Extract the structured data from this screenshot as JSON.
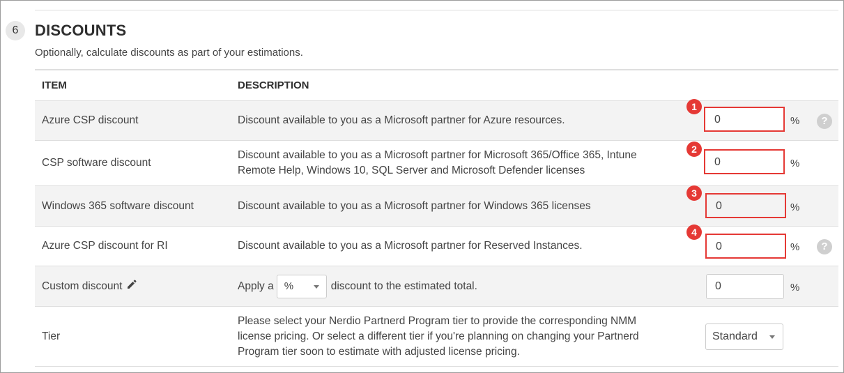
{
  "section": {
    "step": "6",
    "title": "DISCOUNTS",
    "subtitle": "Optionally, calculate discounts as part of your estimations."
  },
  "table": {
    "headers": {
      "item": "ITEM",
      "description": "DESCRIPTION"
    },
    "rows": [
      {
        "item": "Azure CSP discount",
        "description": "Discount available to you as a Microsoft partner for Azure resources.",
        "value": "0",
        "unit": "%",
        "marker": "1",
        "help_icon": "question-circle-icon"
      },
      {
        "item": "CSP software discount",
        "description": "Discount available to you as a Microsoft partner for Microsoft 365/Office 365, Intune Remote Help, Windows 10, SQL Server and Microsoft Defender licenses",
        "value": "0",
        "unit": "%",
        "marker": "2"
      },
      {
        "item": "Windows 365 software discount",
        "description": "Discount available to you as a Microsoft partner for Windows 365 licenses",
        "value": "0",
        "unit": "%",
        "marker": "3"
      },
      {
        "item": "Azure CSP discount for RI",
        "description": "Discount available to you as a Microsoft partner for Reserved Instances.",
        "value": "0",
        "unit": "%",
        "marker": "4",
        "help_icon": "question-circle-icon"
      },
      {
        "item": "Custom discount",
        "item_icon": "pencil-icon",
        "desc_prefix": "Apply a",
        "desc_select": "%",
        "desc_suffix": "discount to the estimated total.",
        "value": "0",
        "unit": "%"
      },
      {
        "item": "Tier",
        "description": "Please select your Nerdio Partnerd Program tier to provide the corresponding NMM license pricing. Or select a different tier if you're planning on changing your Partnerd Program tier soon to estimate with adjusted license pricing.",
        "tier_select": "Standard"
      }
    ]
  },
  "colors": {
    "marker": "#e53935",
    "shaded_row": "#f3f3f3",
    "help_icon": "#cfcfcf"
  }
}
